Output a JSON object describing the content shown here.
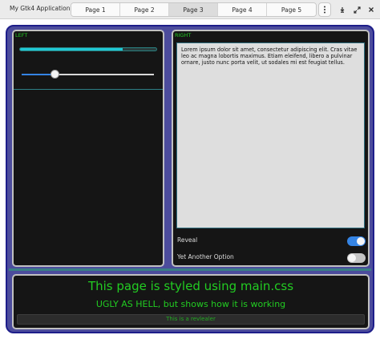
{
  "window": {
    "title": "My Gtk4 Application"
  },
  "tabs": [
    {
      "label": "Page 1",
      "active": false
    },
    {
      "label": "Page 2",
      "active": false
    },
    {
      "label": "Page 3",
      "active": true
    },
    {
      "label": "Page 4",
      "active": false
    },
    {
      "label": "Page 5",
      "active": false
    }
  ],
  "icons": {
    "menu": "vertical-ellipsis-icon",
    "minimize": "minimize-icon",
    "maximize": "maximize-icon"
  },
  "left": {
    "label": "LEFT",
    "progress": 0.75,
    "slider": 0.25
  },
  "right": {
    "label": "RIGHT",
    "text": "Lorem ipsum dolor sit amet, consectetur adipiscing elit. Cras vitae leo ac magna lobortis maximus. Etiam eleifend, libero a pulvinar ornare, justo nunc porta velit, ut sodales mi est feugiat tellus.",
    "switches": [
      {
        "label": "Reveal",
        "on": true
      },
      {
        "label": "Yet Another Option",
        "on": false
      }
    ]
  },
  "bottom": {
    "heading": "This page is styled using main.css",
    "subheading": "UGLY AS HELL, but shows how it is working",
    "revealer_text": "This is a revlealer"
  },
  "colors": {
    "accent": "#3584e4",
    "progress": "#1fc8d4",
    "label_green": "#22cc22",
    "frame": "#4c4c9c",
    "panel_bg": "#151515"
  }
}
